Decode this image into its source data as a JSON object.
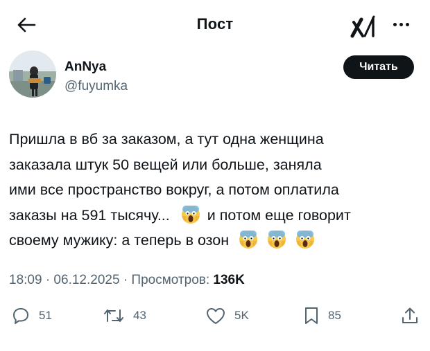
{
  "header": {
    "title": "Пост",
    "read_button": "Читать"
  },
  "icons": {
    "back": "arrow-left-icon",
    "logo": "x-logo",
    "more": "more-dots-icon",
    "reply": "reply-icon",
    "repost": "repost-icon",
    "like": "like-icon",
    "bookmark": "bookmark-icon",
    "share": "share-icon",
    "emoji": "screaming-face-emoji"
  },
  "author": {
    "name": "AnNya",
    "handle": "@fuyumka"
  },
  "post": {
    "lines": [
      "Пришла в вб за заказом, а тут одна женщина",
      "заказала штук 50 вещей или больше, заняла",
      "ими все пространство вокруг, а потом оплатила",
      "заказы на 591 тысячу...",
      "и потом еще говорит",
      "своему мужику: а теперь в озон"
    ],
    "emoji_char": "😱"
  },
  "meta": {
    "time_date": "18:09 · 06.12.2025 · ",
    "views_label": "Просмотров: ",
    "views_count": "136K"
  },
  "actions": {
    "replies": "51",
    "reposts": "43",
    "likes": "5K",
    "bookmarks": "85"
  },
  "colors": {
    "text": "#0f1419",
    "secondary": "#536471",
    "button_bg": "#0f1419",
    "emoji_yellow": "#f7c948"
  }
}
